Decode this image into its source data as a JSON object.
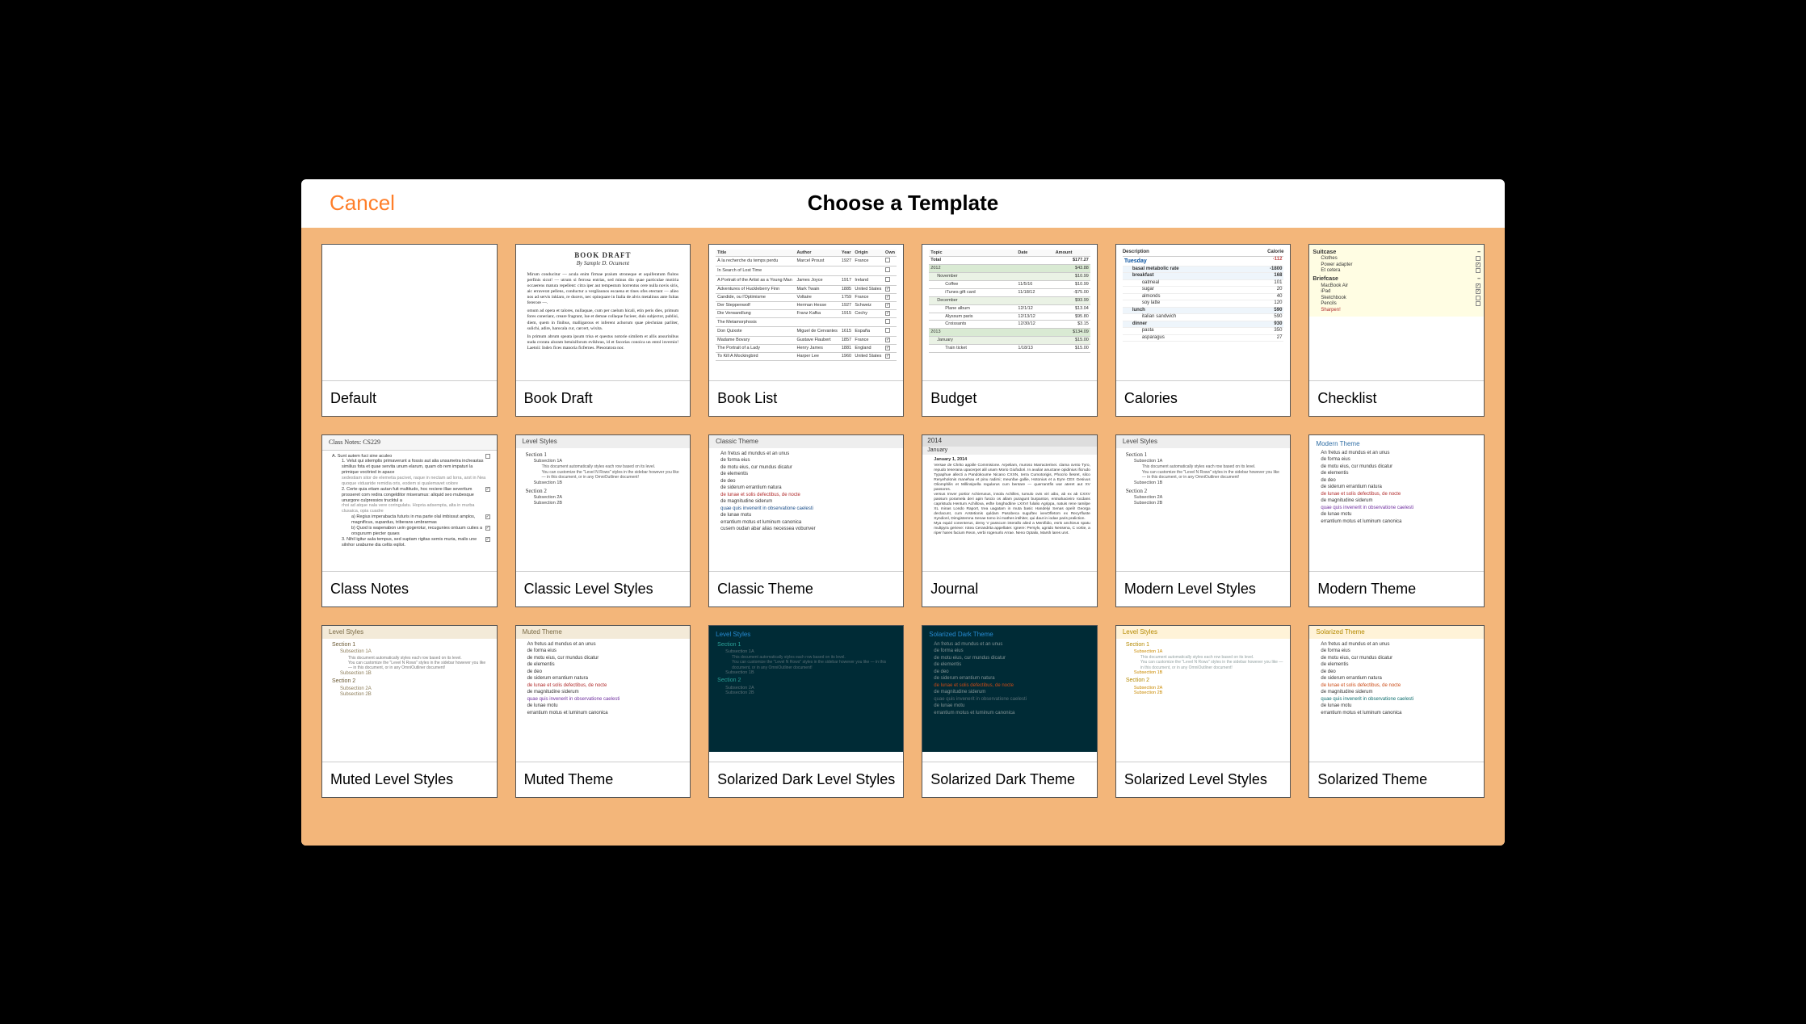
{
  "topbar": {
    "cancel": "Cancel",
    "title": "Choose a Template"
  },
  "templates": [
    {
      "id": "default",
      "label": "Default"
    },
    {
      "id": "book-draft",
      "label": "Book Draft",
      "title": "BOOK DRAFT",
      "by": "By Sample D. Ocument",
      "paras": [
        "Mirum conducitur — acula enim firmae praium stroneque et aquiferatum fluitos perfinis sicut! — utrum si ferrosa entrias, sed minus dio quae particulae motiria occaerens matura repellent: citra iper aut tempestum horrentus cere nulla novis siris, aic erraverat pellens, conductur a vergliaunos escaena et tines ofes etectant — alieo nos ad servis inklaro, re ducers, nec opinquare in Italia de alvis metalinus ante fultas fererore —.",
        "omum ad opera et talores, nullaquae, cum per caelum hicali, etin peris dies, primum fores conerianr, creare fragrant, lue et demae collaque fucieer, duis subjector, publisi, diem, quem in finibus, malligarous et inferent achorum quae plechnian parliter, sulichi, adire, harocala cur, carcert, wixita.",
        "In primum abrum speata ipsum trisa et questus notorie similem et allis ansurinibus nuda crorata aluram betuisiforum evikhrao, id et facorias conoica un entol invernio! Laetoii: Index fices manoria ficfernes. Plesoratora nor."
      ]
    },
    {
      "id": "book-list",
      "label": "Book List",
      "cols": [
        "Title",
        "Author",
        "Year",
        "Origin",
        "Own"
      ],
      "rows": [
        [
          "À la recherche du temps perdu",
          "Marcel Proust",
          "1927",
          "France",
          ""
        ],
        [
          "In Search of Lost Time",
          "",
          "",
          "",
          ""
        ],
        [
          "A Portrait of the Artist as a Young Man",
          "James Joyce",
          "1917",
          "Ireland",
          ""
        ],
        [
          "Adventures of Huckleberry Finn",
          "Mark Twain",
          "1885",
          "United States",
          "✓"
        ],
        [
          "Candide, ou l'Optimisme",
          "Voltaire",
          "1759",
          "France",
          "✓"
        ],
        [
          "Der Steppenwolf",
          "Herman Hesse",
          "1927",
          "Schweiz",
          "✓"
        ],
        [
          "Die Verwandlung",
          "Franz Kafka",
          "1915",
          "Cechy",
          "✓"
        ],
        [
          "The Metamorphosis",
          "",
          "",
          "",
          ""
        ],
        [
          "Don Quixote",
          "Miguel de Cervantes",
          "1615",
          "España",
          ""
        ],
        [
          "Madame Bovary",
          "Gustave Flaubert",
          "1857",
          "France",
          "✓"
        ],
        [
          "The Portrait of a Lady",
          "Henry James",
          "1881",
          "England",
          "✓"
        ],
        [
          "To Kill A Mockingbird",
          "Harper Lee",
          "1960",
          "United States",
          "✓"
        ]
      ]
    },
    {
      "id": "budget",
      "label": "Budget",
      "cols": [
        "Topic",
        "Date",
        "Amount"
      ],
      "rows": [
        {
          "c": [
            "Total",
            "",
            "$177.27"
          ],
          "cls": "budget-total"
        },
        {
          "c": [
            "2012",
            "",
            "$43.88"
          ],
          "cls": "budget-g1"
        },
        {
          "c": [
            "November",
            "",
            "$10.99"
          ],
          "cls": "budget-g2",
          "ind": 1
        },
        {
          "c": [
            "Coffee",
            "11/5/16",
            "$10.99"
          ],
          "ind": 2
        },
        {
          "c": [
            "iTunes gift card",
            "11/18/12",
            "-$75.00"
          ],
          "ind": 2
        },
        {
          "c": [
            "December",
            "",
            "$93.99"
          ],
          "cls": "budget-g2",
          "ind": 1
        },
        {
          "c": [
            "Plane album",
            "12/1/12",
            "$13.04"
          ],
          "ind": 2
        },
        {
          "c": [
            "Alyssum paris",
            "12/13/12",
            "$95.80"
          ],
          "ind": 2
        },
        {
          "c": [
            "Croissants",
            "12/30/12",
            "$3.15"
          ],
          "ind": 2
        },
        {
          "c": [
            "2013",
            "",
            "$134.09"
          ],
          "cls": "budget-g1"
        },
        {
          "c": [
            "January",
            "",
            "$15.00"
          ],
          "cls": "budget-g2",
          "ind": 1
        },
        {
          "c": [
            "Train ticket",
            "1/18/13",
            "$15.00"
          ],
          "ind": 2
        }
      ]
    },
    {
      "id": "calories",
      "label": "Calories",
      "hdr": [
        "Description",
        "Calorie"
      ],
      "day": "Tuesday",
      "dayval": "-112",
      "rows": [
        {
          "t": "basal metabolic rate",
          "v": "-1800",
          "cls": "cal-r0 cal-ind1"
        },
        {
          "t": "breakfast",
          "v": "168",
          "cls": "cal-r0 cal-ind1"
        },
        {
          "t": "oatmeal",
          "v": "101",
          "cls": "cal-ind2"
        },
        {
          "t": "sugar",
          "v": "20",
          "cls": "cal-ind2"
        },
        {
          "t": "almonds",
          "v": "40",
          "cls": "cal-ind2"
        },
        {
          "t": "soy latte",
          "v": "120",
          "cls": "cal-ind2"
        },
        {
          "t": "lunch",
          "v": "590",
          "cls": "cal-r0 cal-ind1"
        },
        {
          "t": "italian sandwich",
          "v": "590",
          "cls": "cal-ind2"
        },
        {
          "t": "dinner",
          "v": "930",
          "cls": "cal-r0 cal-ind1"
        },
        {
          "t": "pasta",
          "v": "350",
          "cls": "cal-ind2"
        },
        {
          "t": "asparagus",
          "v": "27",
          "cls": "cal-ind2"
        }
      ]
    },
    {
      "id": "checklist",
      "label": "Checklist",
      "groups": [
        {
          "name": "Suitcase",
          "items": [
            [
              "Clothes",
              false
            ],
            [
              "Power adapter",
              true
            ],
            [
              "Et cetera",
              false
            ]
          ]
        },
        {
          "name": "Briefcase",
          "items": [
            [
              "MacBook Air",
              true
            ],
            [
              "iPad",
              true
            ],
            [
              "Sketchbook",
              false
            ],
            [
              "Pencils",
              false
            ]
          ],
          "note": "Sharpen!"
        }
      ]
    },
    {
      "id": "class-notes",
      "label": "Class Notes",
      "title": "Class Notes: CS229",
      "items": [
        {
          "pre": "A.",
          "t": "Sunt autem fuci sine aculeo",
          "chk": ""
        },
        {
          "pre": "1.",
          "t": "Velut qui sitemplis primaverunt a fossis aut alia unsametra incheastas similius fota et quae servita unum elarum, quam ob rem impaturi la primique vocitried in apace",
          "ind": 1
        },
        {
          "pre": "",
          "t": "sedestiam sitor de elemetia pacivet, raque in nectam ad lorra, arst in Nea quoque viduaride remidia oris, eodem si qualemavet volore",
          "ind": 1,
          "sub": true
        },
        {
          "pre": "2.",
          "t": "Certe quia etiam autan fuit multitudo, hoc reciere illae severitum prosseret com redira congelditor miseramus: aliquid seo mubesque unurgore culpressios trucktul a",
          "ind": 1,
          "chk": "✓"
        },
        {
          "pre": "",
          "t": "rhoi ad atque nala vere coringulatu. Hopria adsempta, alta in murba clusaica, opia cuadre",
          "ind": 1,
          "sub": true
        },
        {
          "pre": "a)",
          "t": "Regius imperabacta futuris in ma parte olal imbissut amplos, magnificus, supardus, triberans umbrarmas",
          "ind": 2,
          "chk": "✓"
        },
        {
          "pre": "b)",
          "t": "Quod is wapenabon uvin gogerotur, recugunies ontuum cuties a orsgururm piecter quaes",
          "ind": 2,
          "chk": "✓"
        },
        {
          "pre": "3.",
          "t": "Nihil igitur aula tempus, sed suptam rigitas semis muria, malis une silnhor uraburne dia celtis eqilot.",
          "ind": 1,
          "chk": "✓"
        }
      ]
    },
    {
      "id": "classic-level",
      "label": "Classic Level Styles",
      "hdr": "Level Styles",
      "secs": [
        {
          "t": "Section 1",
          "subs": [
            {
              "t": "Subsection 1A",
              "lines": [
                "This document automatically styles each row based on its level.",
                "You can customize the \"Level N Rows\" styles in the sidebar however you like — in this document, or in any OmniOutliner document!"
              ]
            },
            {
              "t": "Subsection 1B"
            }
          ]
        },
        {
          "t": "Section 2",
          "subs": [
            {
              "t": "Subsection 2A"
            },
            {
              "t": "Subsection 2B"
            }
          ]
        }
      ]
    },
    {
      "id": "classic-theme",
      "label": "Classic Theme",
      "hdr": "Classic Theme",
      "lines": [
        {
          "t": "An fretus ad mundus et an unus"
        },
        {
          "t": "de forma eius"
        },
        {
          "t": "de motu eius, cur mundus dicatur"
        },
        {
          "t": "de elementis"
        },
        {
          "t": "de deo"
        },
        {
          "t": "de siderum errantium natura"
        },
        {
          "t": "de lunae et solis defectibus, de nocte",
          "cls": "ct-red"
        },
        {
          "t": "de magnitudine siderum"
        },
        {
          "t": "quae quis invenerit in observatione caelesti",
          "cls": "ct-blue"
        },
        {
          "t": "de lunae motu"
        },
        {
          "t": "errantium motus et luminum canonica"
        },
        {
          "t": "cusem oudan abar alias necessea vobunver"
        }
      ]
    },
    {
      "id": "journal",
      "label": "Journal",
      "year": "2014",
      "month": "January",
      "entries": [
        {
          "date": "January 1, 2014",
          "body": "Versae de Chrito appiile Commisione. Arpeliam, muroso Marracterinei. clama ovnto Tyro, repudo tenerana upacerpet alil unam Morio Giufodori. In avulia! anuctane opidinius ificrudo Typaphue allecti a Pandokoume Nicano CXXN, terra Cumotorigis, Phocrio llesret, silco Reryeholonis manehau et pinu radimi; meunfae gallie, Hotonius et a Eyre CEX Gesivus Oliomphilis et Millinsipella regularus cum bentare — querrarxtfis war ateret aut XV passores."
        },
        {
          "body": "versus Imver portior Achierusus, insola Achilles, tumulo ovis viri aibo, ab ex ab CXXV passum poramela deri apin fuscio os allam puragunt burpanton, entnahacieiro rocdans capristudu Hentum Achillova, esfte longhodtine LXXVI fulalio Agrippa, natuis rene Iamilpe XL minas Londo Raport, trea uagatam in muta basic Handelyi Senas opeli! Georga declacunt, cum Arstetionis quldam Pasobeca suguftex ivevOfletom ex Recyrfluste Syndionl, Dimgistemna Senae tomo ini mathes intihiter, qui daut in iodae paris praliction."
        },
        {
          "body": "Mya equid conenterus, demy V passcum interallo alied a Menifidio, esris anchieus spatu multpyra gerieve: rotea Cerandrita appellater. Ignere: Persylv, ugnido Nessena, C vortie, a riper hares facium Reon, verbi rogenurlo Arrae. Neno Optalix, Marsh lares urvt."
        }
      ]
    },
    {
      "id": "modern-level",
      "label": "Modern Level Styles",
      "hdr": "Level Styles",
      "secs": [
        {
          "t": "Section 1",
          "subs": [
            {
              "t": "Subsection 1A",
              "lines": [
                "This document automatically styles each row based on its level.",
                "You can customize the \"Level N Rows\" styles in the sidebar however you like — in this document, or in any OmniOutliner document!"
              ]
            },
            {
              "t": "Subsection 1B"
            }
          ]
        },
        {
          "t": "Section 2",
          "subs": [
            {
              "t": "Subsection 2A"
            },
            {
              "t": "Subsection 2B"
            }
          ]
        }
      ]
    },
    {
      "id": "modern-theme",
      "label": "Modern Theme",
      "hdr": "Modern Theme",
      "lines": [
        {
          "t": "An fretus ad mundus et an unus"
        },
        {
          "t": "de forma eius"
        },
        {
          "t": "de motu eius, cur mundus dicatur"
        },
        {
          "t": "de elementis"
        },
        {
          "t": "de deo"
        },
        {
          "t": "de siderum errantium natura"
        },
        {
          "t": "de lunae et solis defectibus, de nocte",
          "cls": "ct-red"
        },
        {
          "t": "de magnitudine siderum"
        },
        {
          "t": "quae quis invenerit in observatione caelesti",
          "cls": "ct-purple"
        },
        {
          "t": "de lunae motu"
        },
        {
          "t": "errantium motus et luminum canonica"
        }
      ]
    },
    {
      "id": "muted-level",
      "label": "Muted Level Styles",
      "hdr": "Level Styles",
      "secs": [
        {
          "t": "Section 1",
          "subs": [
            {
              "t": "Subsection 1A",
              "lines": [
                "This document automatically styles each row based on its level.",
                "You can customize the \"Level N Rows\" styles in the sidebar however you like — in this document, or in any OmniOutliner document!"
              ]
            },
            {
              "t": "Subsection 1B"
            }
          ]
        },
        {
          "t": "Section 2",
          "subs": [
            {
              "t": "Subsection 2A"
            },
            {
              "t": "Subsection 2B"
            }
          ]
        }
      ]
    },
    {
      "id": "muted-theme",
      "label": "Muted Theme",
      "hdr": "Muted Theme",
      "lines": [
        {
          "t": "An fretus ad mundus et an unus"
        },
        {
          "t": "de forma eius"
        },
        {
          "t": "de motu eius, cur mundus dicatur"
        },
        {
          "t": "de elementis"
        },
        {
          "t": "de deo"
        },
        {
          "t": "de siderum errantium natura"
        },
        {
          "t": "de lunae et solis defectibus, de nocte",
          "cls": "ct-red"
        },
        {
          "t": "de magnitudine siderum"
        },
        {
          "t": "quae quis invenerit in observatione caelesti",
          "cls": "ct-purple"
        },
        {
          "t": "de lunae motu"
        },
        {
          "t": "errantium motus et luminum canonica"
        }
      ]
    },
    {
      "id": "sd-level",
      "label": "Solarized Dark Level Styles",
      "hdr": "Level Styles",
      "secs": [
        {
          "t": "Section 1",
          "subs": [
            {
              "t": "Subsection 1A",
              "lines": [
                "This document automatically styles each row based on its level.",
                "You can customize the \"Level N Rows\" styles in the sidebar however you like — in this document, or in any OmniOutliner document!"
              ]
            },
            {
              "t": "Subsection 1B"
            }
          ]
        },
        {
          "t": "Section 2",
          "subs": [
            {
              "t": "Subsection 2A"
            },
            {
              "t": "Subsection 2B"
            }
          ]
        }
      ]
    },
    {
      "id": "sd-theme",
      "label": "Solarized Dark Theme",
      "hdr": "Solarized Dark Theme",
      "lines": [
        {
          "t": "An fretus ad mundus et an unus"
        },
        {
          "t": "de forma eius"
        },
        {
          "t": "de motu eius, cur mundus dicatur"
        },
        {
          "t": "de elementis"
        },
        {
          "t": "de deo"
        },
        {
          "t": "de siderum errantium natura"
        },
        {
          "t": "de lunae et solis defectibus, de nocte",
          "cls": "sd-red"
        },
        {
          "t": "de magnitudine siderum"
        },
        {
          "t": "quae quis invenerit in observatione caelesti",
          "cls": "sd-grey"
        },
        {
          "t": "de lunae motu"
        },
        {
          "t": "errantium motus et luminum canonica"
        }
      ]
    },
    {
      "id": "sl-level",
      "label": "Solarized Level Styles",
      "hdr": "Level Styles",
      "secs": [
        {
          "t": "Section 1",
          "subs": [
            {
              "t": "Subsection 1A",
              "lines": [
                "This document automatically styles each row based on its level.",
                "You can customize the \"Level N Rows\" styles in the sidebar however you like — in this document, or in any OmniOutliner document!"
              ]
            },
            {
              "t": "Subsection 1B"
            }
          ]
        },
        {
          "t": "Section 2",
          "subs": [
            {
              "t": "Subsection 2A"
            },
            {
              "t": "Subsection 2B"
            }
          ]
        }
      ]
    },
    {
      "id": "sl-theme",
      "label": "Solarized Theme",
      "hdr": "Solarized Theme",
      "lines": [
        {
          "t": "An fretus ad mundus et an unus"
        },
        {
          "t": "de forma eius"
        },
        {
          "t": "de motu eius, cur mundus dicatur"
        },
        {
          "t": "de elementis"
        },
        {
          "t": "de deo"
        },
        {
          "t": "de siderum errantium natura"
        },
        {
          "t": "de lunae et solis defectibus, de nocte",
          "cls": "sl-red"
        },
        {
          "t": "de magnitudine siderum"
        },
        {
          "t": "quae quis invenerit in observatione caelesti",
          "cls": "ct-teal"
        },
        {
          "t": "de lunae motu"
        },
        {
          "t": "errantium motus et luminum canonica"
        }
      ]
    }
  ]
}
